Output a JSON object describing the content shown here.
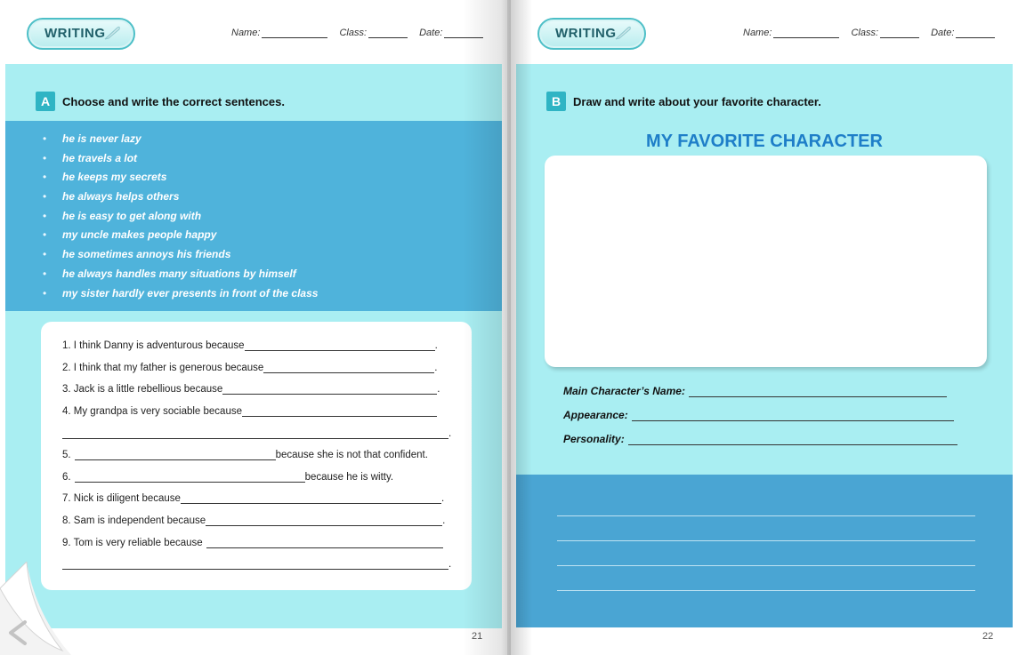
{
  "left_page": {
    "badge": "WRITING",
    "header": {
      "name": "Name:",
      "class": "Class:",
      "date": "Date:"
    },
    "section": {
      "letter": "A",
      "title": "Choose and write the correct sentences."
    },
    "options": [
      "he is never lazy",
      "he travels a lot",
      "he keeps my secrets",
      "he always helps others",
      "he is easy to get along with",
      "my uncle makes people happy",
      "he sometimes annoys his friends",
      "he always handles many situations by himself",
      "my sister hardly ever presents in front of the class"
    ],
    "questions": {
      "q1": "1. I think Danny is adventurous because",
      "q2": "2. I think that my father is generous because",
      "q3": "3. Jack is a little rebellious because",
      "q4": "4. My grandpa is very sociable because",
      "q5_num": "5.",
      "q5_text": "because she is not that confident.",
      "q6_num": "6.",
      "q6_text": "because he is witty.",
      "q7": "7. Nick is diligent because",
      "q8": "8. Sam is independent because",
      "q9": "9. Tom is very reliable because",
      "period": "."
    },
    "page_number": "21"
  },
  "right_page": {
    "badge": "WRITING",
    "header": {
      "name": "Name:",
      "class": "Class:",
      "date": "Date:"
    },
    "section": {
      "letter": "B",
      "title": "Draw and write about your favorite character."
    },
    "heading": "MY FAVORITE CHARACTER",
    "fields": {
      "name": "Main Character’s Name:",
      "appearance": "Appearance:",
      "personality": "Personality:"
    },
    "page_number": "22"
  },
  "colors": {
    "panel_light": "#a9eef2",
    "panel_blue": "#4fb3db",
    "heading_blue": "#1e7ec8",
    "section_badge": "#2fb4c4"
  },
  "icons": [
    "quill-icon",
    "page-curl-prev-icon"
  ]
}
